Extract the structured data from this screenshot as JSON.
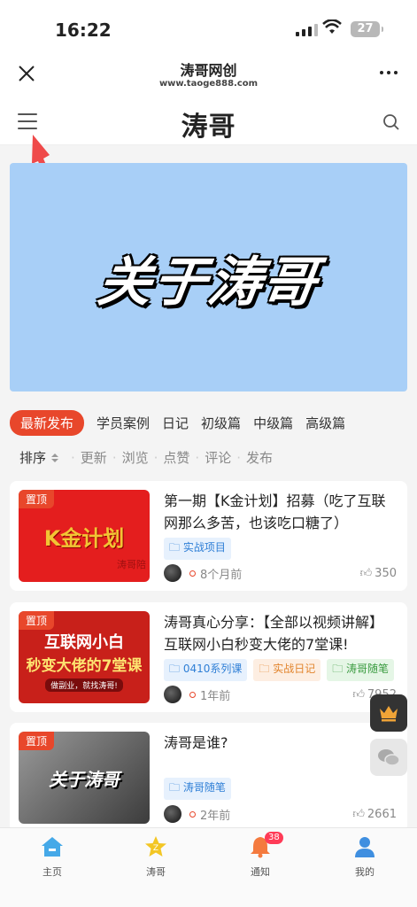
{
  "status": {
    "time": "16:22",
    "battery": "27"
  },
  "nav": {
    "title": "涛哥网创",
    "subtitle": "www.taoge888.com"
  },
  "header": {
    "logo": "涛哥"
  },
  "banner": {
    "text": "关于涛哥"
  },
  "tabs": [
    "最新发布",
    "学员案例",
    "日记",
    "初级篇",
    "中级篇",
    "高级篇"
  ],
  "sort": {
    "label": "排序",
    "options": [
      "更新",
      "浏览",
      "点赞",
      "评论",
      "发布"
    ]
  },
  "posts": [
    {
      "pin": "置顶",
      "title": "第一期【K金计划】招募（吃了互联网那么多苦，也该吃口糖了）",
      "tags": [
        "实战项目"
      ],
      "time": "8个月前",
      "likes": "350",
      "thumb_text": "K金计划",
      "thumb_sub": "涛哥陪"
    },
    {
      "pin": "置顶",
      "title": "涛哥真心分享：【全部以视频讲解】互联网小白秒变大佬的7堂课!",
      "tags": [
        "0410系列课",
        "实战日记",
        "涛哥随笔"
      ],
      "time": "1年前",
      "likes": "7952",
      "thumb_text1": "互联网小白",
      "thumb_text2": "秒变大佬的7堂课",
      "thumb_sub": "做副业，就找涛哥!"
    },
    {
      "pin": "置顶",
      "title": "涛哥是谁?",
      "tags": [
        "涛哥随笔"
      ],
      "time": "2年前",
      "likes": "2661",
      "thumb_text": "关于涛哥"
    }
  ],
  "tabbar": [
    {
      "label": "主页"
    },
    {
      "label": "涛哥"
    },
    {
      "label": "通知",
      "badge": "38"
    },
    {
      "label": "我的"
    }
  ],
  "colors": {
    "accent": "#e8472b",
    "banner": "#a8cff7"
  }
}
